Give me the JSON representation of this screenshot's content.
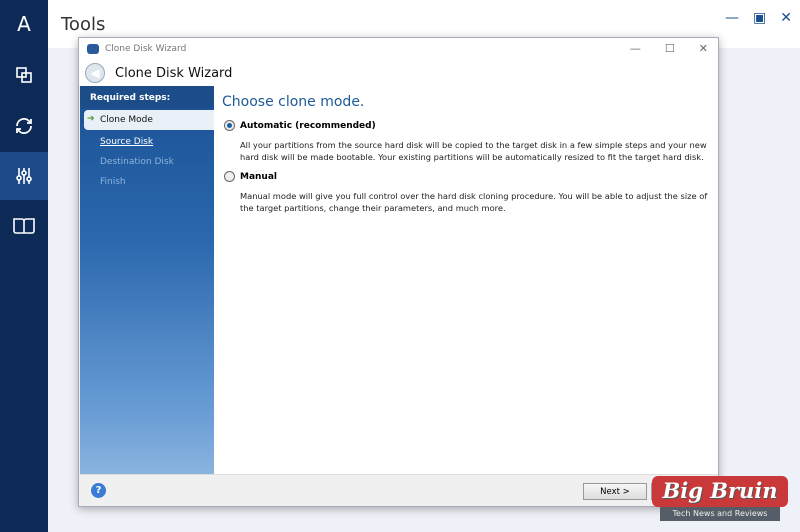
{
  "app": {
    "title": "Tools",
    "nav": [
      {
        "icon": "logo-a-icon"
      },
      {
        "icon": "backup-icon"
      },
      {
        "icon": "sync-icon"
      },
      {
        "icon": "tools-icon",
        "active": true
      },
      {
        "icon": "book-icon"
      }
    ],
    "window_controls": [
      "—",
      "▣",
      "✕"
    ]
  },
  "dialog": {
    "window_title": "Clone Disk Wizard",
    "header": "Clone Disk Wizard",
    "steps_title": "Required steps:",
    "steps": [
      {
        "label": "Clone Mode",
        "state": "current"
      },
      {
        "label": "Source Disk",
        "state": "link"
      },
      {
        "label": "Destination Disk",
        "state": "disabled"
      },
      {
        "label": "Finish",
        "state": "disabled"
      }
    ],
    "heading": "Choose clone mode.",
    "options": [
      {
        "label": "Automatic (recommended)",
        "selected": true,
        "description": "All your partitions from the source hard disk will be copied to the target disk in a few simple steps and your new hard disk will be made bootable. Your existing partitions will be automatically resized to fit the target hard disk."
      },
      {
        "label": "Manual",
        "selected": false,
        "description": "Manual mode will give you full control over the hard disk cloning procedure. You will be able to adjust the size of the target partitions, change their parameters, and much more."
      }
    ],
    "next_label": "Next >",
    "help": "?"
  },
  "watermark": {
    "brand": "Big Bruin",
    "tagline": "Tech News and Reviews",
    "color": "#c9393a"
  }
}
